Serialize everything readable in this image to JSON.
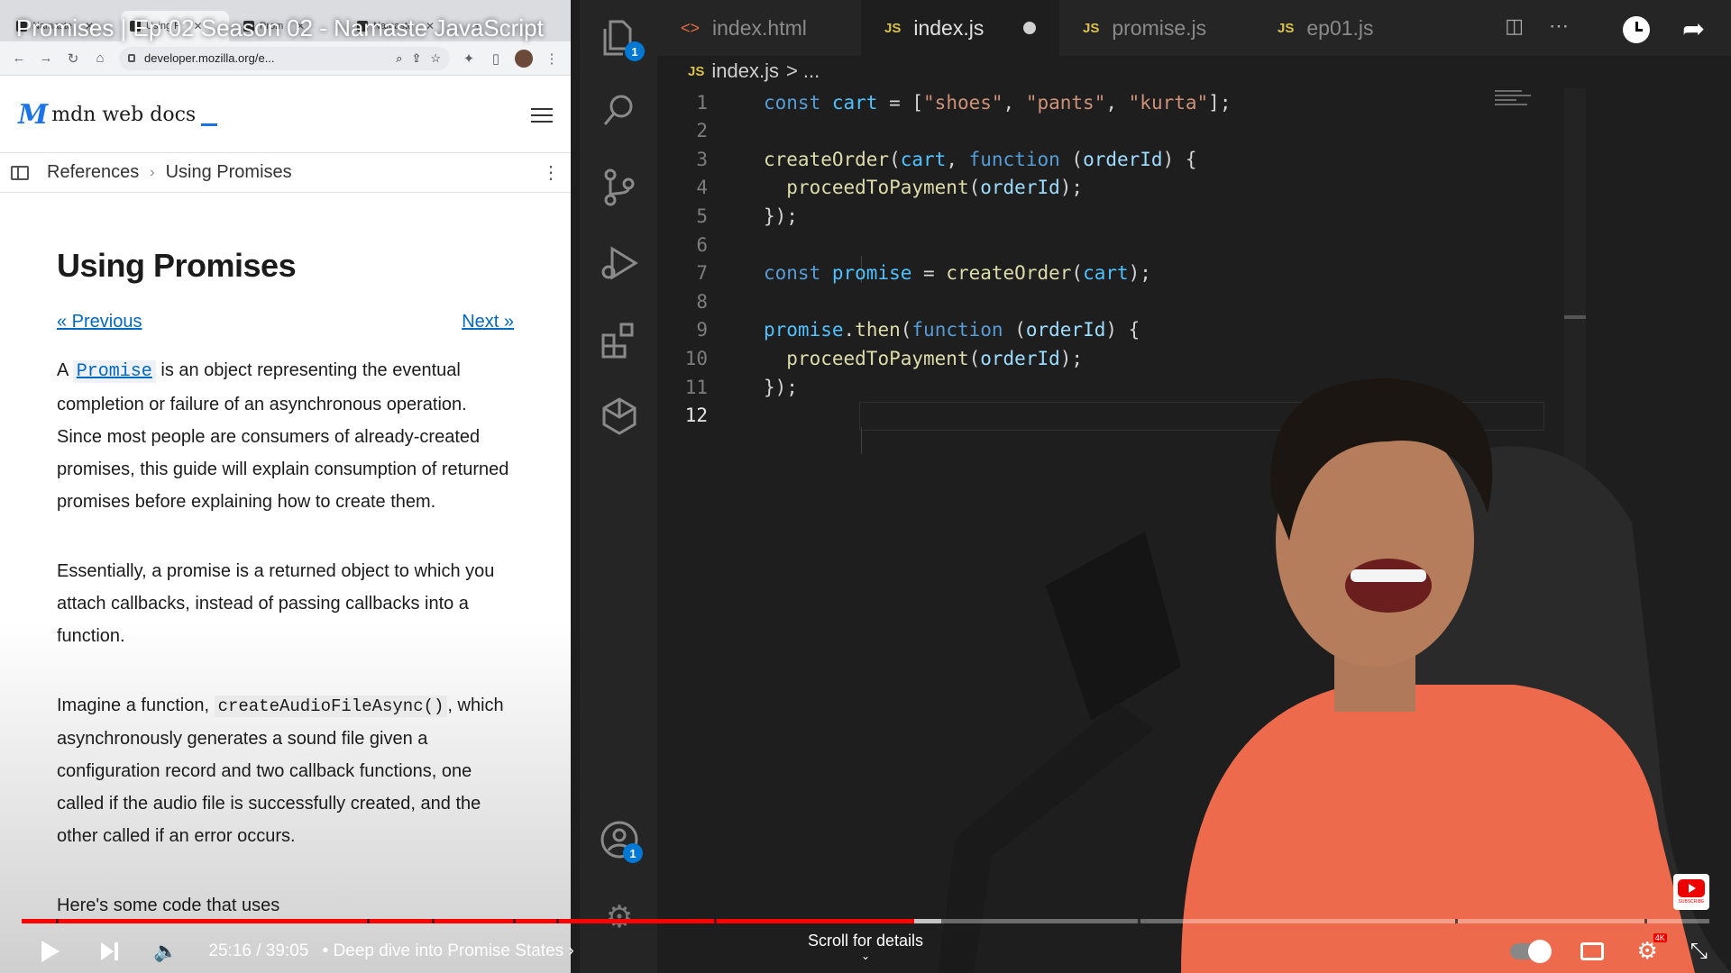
{
  "video": {
    "title": "Promises | Ep 02 Season 02 - Namaste JavaScript",
    "time_current": "25:16",
    "time_total": "39:05",
    "chapter": "Deep dive into Promise States",
    "scroll_hint": "Scroll for details",
    "progress_fraction": 0.529,
    "buffer_fraction": 0.545,
    "subscribe_label": "SUBSCRIBE"
  },
  "browser": {
    "tabs": [
      {
        "label": "Namaste"
      },
      {
        "label": "Using P"
      },
      {
        "label": "Prom"
      },
      {
        "label": "Namaste"
      }
    ],
    "url": "developer.mozilla.org/e..."
  },
  "mdn": {
    "logo_mark": "M",
    "logo_text": "mdn web docs",
    "breadcrumb": [
      "References",
      "Using Promises"
    ],
    "title": "Using Promises",
    "prev_label": "« Previous",
    "next_label": "Next »",
    "p1_pre": "A ",
    "p1_code": "Promise",
    "p1_post": " is an object representing the eventual completion or failure of an asynchronous operation. Since most people are consumers of already-created promises, this guide will explain consumption of returned promises before explaining how to create them.",
    "p2": "Essentially, a promise is a returned object to which you attach callbacks, instead of passing callbacks into a function.",
    "p3_pre": "Imagine a function, ",
    "p3_code": "createAudioFileAsync()",
    "p3_post": ", which asynchronously generates a sound file given a configuration record and two callback functions, one called if the audio file is successfully created, and the other called if an error occurs.",
    "p4_partial": "Here's some code that uses"
  },
  "vscode": {
    "tabs": [
      {
        "label": "index.html",
        "type": "html"
      },
      {
        "label": "index.js",
        "type": "js"
      },
      {
        "label": "promise.js",
        "type": "js"
      },
      {
        "label": "ep01.js",
        "type": "js"
      }
    ],
    "breadcrumb_file": "index.js",
    "breadcrumb_rest": "> ...",
    "explorer_badge": "1",
    "accounts_badge": "1",
    "line_numbers": [
      "1",
      "2",
      "3",
      "4",
      "5",
      "6",
      "7",
      "8",
      "9",
      "10",
      "11",
      "12"
    ],
    "lines": {
      "l1": {
        "kw": "const",
        "var": "cart",
        "eq": " = [",
        "s1": "\"shoes\"",
        "c1": ", ",
        "s2": "\"pants\"",
        "c2": ", ",
        "s3": "\"kurta\"",
        "end": "];"
      },
      "l3": {
        "fn": "createOrder",
        "p1": "(",
        "a1": "cart",
        "p2": ", ",
        "kw": "function",
        "p3": " (",
        "a2": "orderId",
        "p4": ") {"
      },
      "l4": {
        "fn": "proceedToPayment",
        "p1": "(",
        "a1": "orderId",
        "p2": ");"
      },
      "l5": {
        "text": "});"
      },
      "l7": {
        "kw": "const",
        "var": "promise",
        "eq": " = ",
        "fn": "createOrder",
        "p1": "(",
        "a1": "cart",
        "p2": ");"
      },
      "l9": {
        "var": "promise",
        "dot": ".",
        "fn": "then",
        "p1": "(",
        "kw": "function",
        "p2": " (",
        "a1": "orderId",
        "p3": ") {"
      },
      "l10": {
        "fn": "proceedToPayment",
        "p1": "(",
        "a1": "orderId",
        "p2": ");"
      },
      "l11": {
        "text": "});"
      }
    }
  },
  "colors": {
    "keyword": "#569cd6",
    "variable": "#4fc1ff",
    "string": "#ce9178",
    "function": "#dcdcaa",
    "progress": "#ff0000",
    "mdn_link": "#0069c2"
  }
}
